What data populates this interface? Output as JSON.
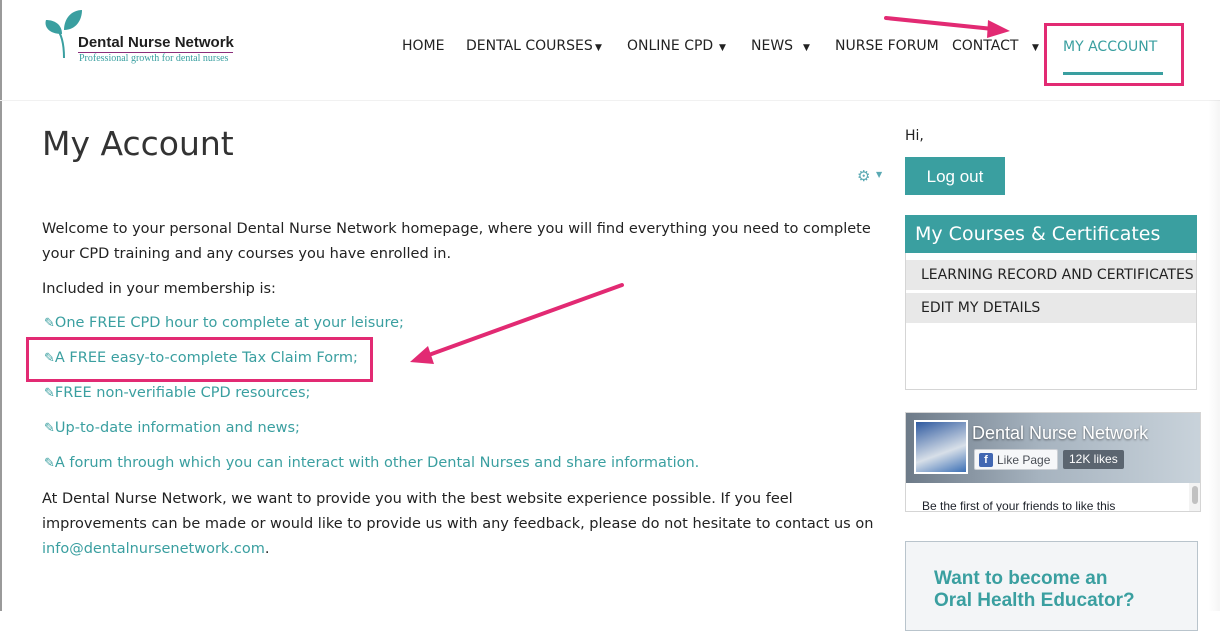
{
  "brand": {
    "name": "Dental Nurse Network",
    "tagline": "Professional growth for dental nurses"
  },
  "nav": {
    "items": [
      {
        "label": "HOME",
        "has_dropdown": false
      },
      {
        "label": "DENTAL COURSES",
        "has_dropdown": true
      },
      {
        "label": "ONLINE CPD",
        "has_dropdown": true
      },
      {
        "label": "NEWS",
        "has_dropdown": true
      },
      {
        "label": "NURSE FORUM",
        "has_dropdown": false
      },
      {
        "label": "CONTACT",
        "has_dropdown": true
      },
      {
        "label": "MY ACCOUNT",
        "has_dropdown": false,
        "active": true
      }
    ]
  },
  "main": {
    "title": "My Account",
    "gear_icon": "gear-icon",
    "intro": "Welcome to your personal Dental Nurse Network homepage, where you will find everything you need to complete your CPD training and any courses you have enrolled in.",
    "included_label": "Included in your membership is:",
    "links": [
      "One FREE CPD hour to complete at your leisure;",
      "A FREE easy-to-complete Tax Claim Form;",
      "FREE non-verifiable CPD resources;",
      "Up-to-date information and news;",
      "A forum through which you can interact with other Dental Nurses and share information."
    ],
    "link_icon": "paperclip-icon",
    "clip_glyph": "✎",
    "feedback": "At Dental Nurse Network, we want to provide you with the best website experience possible. If you feel improvements can be made or would like to provide us with any feedback, please do not hesitate to contact us on",
    "email": "info@dentalnursenetwork.com",
    "email_suffix": "."
  },
  "sidebar": {
    "greeting": "Hi,",
    "logout_label": "Log out",
    "courses_block": {
      "title": "My Courses & Certificates",
      "items": [
        "LEARNING RECORD AND CERTIFICATES",
        "EDIT MY DETAILS"
      ]
    },
    "facebook": {
      "page_name": "Dental Nurse Network",
      "like_label": "Like Page",
      "like_count": "12K likes",
      "friends_text": "Be the first of your friends to like this"
    },
    "promo": {
      "line1": "Want to become an",
      "line2": "Oral Health Educator?"
    }
  },
  "colors": {
    "accent": "#3a9fa0",
    "highlight": "#e22a73",
    "facebook": "#4267b2"
  }
}
